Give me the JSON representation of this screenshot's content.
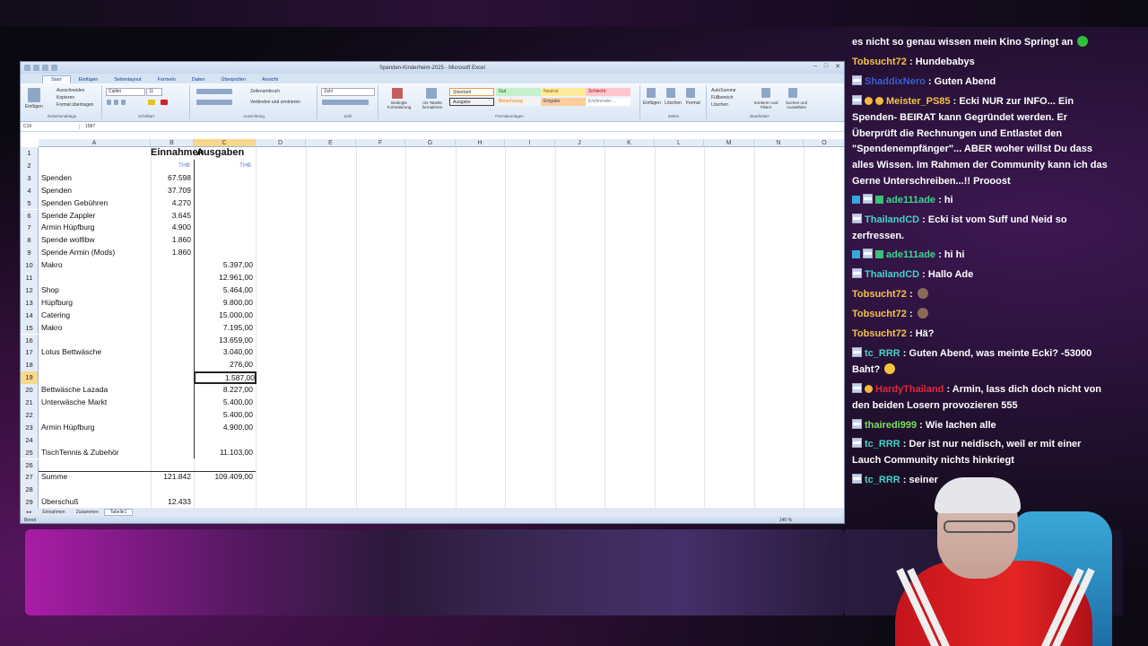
{
  "excel": {
    "title": "Spenden-Kinderheim-2025 - Microsoft Excel",
    "tabs": [
      "Start",
      "Einfügen",
      "Seitenlayout",
      "Formeln",
      "Daten",
      "Überprüfen",
      "Ansicht"
    ],
    "ribbon": {
      "clipboard": {
        "paste": "Einfügen",
        "cut": "Ausschneiden",
        "copy": "Kopieren",
        "format": "Format übertragen",
        "label": "Zwischenablage"
      },
      "font": {
        "name": "Calibri",
        "size": "11",
        "label": "Schriftart"
      },
      "alignment": {
        "wrap": "Zeilenumbruch",
        "merge": "Verbinden und zentrieren",
        "label": "Ausrichtung"
      },
      "number": {
        "format": "Zahl",
        "label": "Zahl"
      },
      "conditional": "Bedingte Formatierung",
      "as_table": "Als Tabelle formatieren",
      "styles": {
        "standard": "Standard",
        "gut": "Gut",
        "neutral": "Neutral",
        "schlecht": "Schlecht",
        "ausgabe": "Ausgabe",
        "berechnung": "Berechnung",
        "eingabe": "Eingabe",
        "erklaerend": "Erklärender ...",
        "label": "Formatvorlagen"
      },
      "cells": {
        "insert": "Einfügen",
        "delete": "Löschen",
        "format": "Format",
        "label": "Zellen"
      },
      "editing": {
        "autosum": "AutoSumme",
        "fill": "Füllbereich",
        "clear": "Löschen",
        "sort": "Sortieren und Filtern",
        "find": "Suchen und Auswählen",
        "label": "Bearbeiten"
      }
    },
    "name_box": "C19",
    "formula": "1587",
    "columns": [
      "A",
      "B",
      "C",
      "D",
      "E",
      "F",
      "G",
      "H",
      "I",
      "J",
      "K",
      "L",
      "M",
      "N",
      "O"
    ],
    "rows": [
      {
        "n": "1",
        "a": "",
        "b": "Einnahmen",
        "c": "Ausgaben"
      },
      {
        "n": "2",
        "a": "",
        "b": "THB",
        "c": "THB"
      },
      {
        "n": "3",
        "a": "Spenden",
        "b": "67.598",
        "c": ""
      },
      {
        "n": "4",
        "a": "Spenden",
        "b": "37.709",
        "c": ""
      },
      {
        "n": "5",
        "a": "Spenden Gebühren",
        "b": "4.270",
        "c": ""
      },
      {
        "n": "6",
        "a": "Spende Zappler",
        "b": "3.645",
        "c": ""
      },
      {
        "n": "7",
        "a": "Armin Hüpfburg",
        "b": "4.900",
        "c": ""
      },
      {
        "n": "8",
        "a": "Spende wolfibw",
        "b": "1.860",
        "c": ""
      },
      {
        "n": "9",
        "a": "Spende Armin (Mods)",
        "b": "1.860",
        "c": ""
      },
      {
        "n": "10",
        "a": "Makro",
        "b": "",
        "c": "5.397,00"
      },
      {
        "n": "11",
        "a": "",
        "b": "",
        "c": "12.961,00"
      },
      {
        "n": "12",
        "a": "Shop",
        "b": "",
        "c": "5.464,00"
      },
      {
        "n": "13",
        "a": "Hüpfburg",
        "b": "",
        "c": "9.800,00"
      },
      {
        "n": "14",
        "a": "Catering",
        "b": "",
        "c": "15.000,00"
      },
      {
        "n": "15",
        "a": "Makro",
        "b": "",
        "c": "7.195,00"
      },
      {
        "n": "16",
        "a": "",
        "b": "",
        "c": "13.659,00"
      },
      {
        "n": "17",
        "a": "Lotus Bettwäsche",
        "b": "",
        "c": "3.040,00"
      },
      {
        "n": "18",
        "a": "",
        "b": "",
        "c": "276,00"
      },
      {
        "n": "19",
        "a": "",
        "b": "",
        "c": "1.587,00"
      },
      {
        "n": "20",
        "a": "Bettwäsche Lazada",
        "b": "",
        "c": "8.227,00"
      },
      {
        "n": "21",
        "a": "Unterwäsche Markt",
        "b": "",
        "c": "5.400,00"
      },
      {
        "n": "22",
        "a": "",
        "b": "",
        "c": "5.400,00"
      },
      {
        "n": "23",
        "a": "Armin Hüpfburg",
        "b": "",
        "c": "4.900,00"
      },
      {
        "n": "24",
        "a": "",
        "b": "",
        "c": ""
      },
      {
        "n": "25",
        "a": "TischTennis & Zubehör",
        "b": "",
        "c": "11.103,00"
      },
      {
        "n": "26",
        "a": "",
        "b": "",
        "c": ""
      },
      {
        "n": "27",
        "a": "Summe",
        "b": "121.842",
        "c": "109.409,00"
      },
      {
        "n": "28",
        "a": "",
        "b": "",
        "c": ""
      },
      {
        "n": "29",
        "a": "Überschuß",
        "b": "12.433",
        "c": ""
      }
    ],
    "sheets": [
      "Einnahmen",
      "Zusammen",
      "Tabelle1"
    ],
    "status": "Bereit",
    "zoom": "145 %"
  },
  "chat": [
    {
      "user": "",
      "text": "es nicht so genau wissen mein Kino Springt an",
      "user_color": "#ffffff",
      "badges": [],
      "emoji": "#2fbf3a"
    },
    {
      "user": "Tobsucht72",
      "text": ": Hundebabys",
      "user_color": "#f3c24a",
      "badges": []
    },
    {
      "user": "ShaddixNero",
      "text": ": Guten Abend",
      "user_color": "#3a5fd0",
      "badges": [
        "flag"
      ]
    },
    {
      "user": "Meister_PS85",
      "text": ": Ecki NUR zur INFO... Ein Spenden- BEIRAT kann Gegründet werden. Er Überprüft die Rechnungen und Entlastet den \"Spendenempfänger\"... ABER woher willst Du dass alles Wissen. Im Rahmen der Community kann ich das Gerne Unterschreiben...!! Prooost",
      "user_color": "#f3c24a",
      "badges": [
        "flag",
        "gold",
        "gold"
      ]
    },
    {
      "user": "ade111ade",
      "text": ": hi",
      "user_color": "#3dd68c",
      "badges": [
        "blue",
        "flag",
        "green"
      ]
    },
    {
      "user": "ThailandCD",
      "text": ": Ecki ist vom Suff und Neid so zerfressen.",
      "user_color": "#47d1c8",
      "badges": [
        "flag"
      ]
    },
    {
      "user": "ade111ade",
      "text": ": hi hi",
      "user_color": "#3dd68c",
      "badges": [
        "blue",
        "flag",
        "green"
      ]
    },
    {
      "user": "ThailandCD",
      "text": ": Hallo Ade",
      "user_color": "#47d1c8",
      "badges": [
        "flag"
      ]
    },
    {
      "user": "Tobsucht72",
      "text": ":",
      "user_color": "#f3c24a",
      "badges": [],
      "emoji": "#8a6a5a"
    },
    {
      "user": "Tobsucht72",
      "text": ":",
      "user_color": "#f3c24a",
      "badges": [],
      "emoji": "#8a6a5a"
    },
    {
      "user": "Tobsucht72",
      "text": ": Hä?",
      "user_color": "#f3c24a",
      "badges": []
    },
    {
      "user": "tc_RRR",
      "text": ": Guten Abend, was meinte Ecki? -53000 Baht?",
      "user_color": "#47d1c8",
      "badges": [
        "flag"
      ],
      "emoji": "#f2c53a"
    },
    {
      "user": "HardyThailand",
      "text": ": Armin, lass dich doch nicht von den beiden Losern provozieren 555",
      "user_color": "#e0263f",
      "badges": [
        "flag",
        "gold"
      ]
    },
    {
      "user": "thairedi999",
      "text": ": Wie lachen alle",
      "user_color": "#7ae05a",
      "badges": [
        "flag"
      ]
    },
    {
      "user": "tc_RRR",
      "text": ": Der ist nur neidisch, weil er mit einer Lauch Community nichts hinkriegt",
      "user_color": "#47d1c8",
      "badges": [
        "flag"
      ]
    },
    {
      "user": "tc_RRR",
      "text": ": seiner",
      "user_color": "#47d1c8",
      "badges": [
        "flag"
      ]
    }
  ]
}
